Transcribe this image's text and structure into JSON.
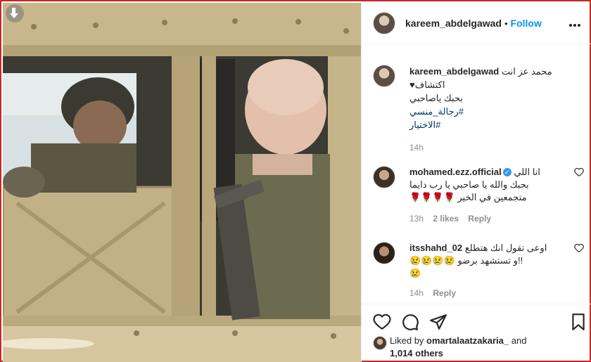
{
  "post": {
    "username": "kareem_abdelgawad",
    "follow_label": "Follow",
    "caption_lines": [
      "محمد عز انت",
      "اكتشاف♥",
      "بحبك ياصاحبي"
    ],
    "hashtags": [
      "#رجالة_منسي",
      "#الاختيار"
    ],
    "caption_time": "14h"
  },
  "comments": [
    {
      "username": "mohamed.ezz.official",
      "verified": true,
      "lines": [
        "انا اللي",
        "بحبك والله يا صاحبي يا رب دايما",
        "متجمعين في الخير 🌹🌹🌹🌹"
      ],
      "time": "13h",
      "likes": "2 likes",
      "reply_label": "Reply"
    },
    {
      "username": "itsshahd_02",
      "verified": false,
      "lines": [
        "اوعى تقول انك هتطلع",
        "!!و تستشهد برضو 😢😢😢😢",
        "😢"
      ],
      "time": "14h",
      "reply_label": "Reply"
    }
  ],
  "likes": {
    "prefix": "Liked by",
    "user": "omartalaatzakaria_",
    "conj": "and",
    "others": "1,014 others"
  },
  "icons": {
    "download": "download-icon",
    "like": "heart-icon",
    "comment": "comment-icon",
    "share": "share-icon",
    "save": "bookmark-icon",
    "more": "more-icon"
  },
  "colors": {
    "accent": "#0095f6",
    "verified": "#3897f0",
    "border": "#c62828"
  }
}
